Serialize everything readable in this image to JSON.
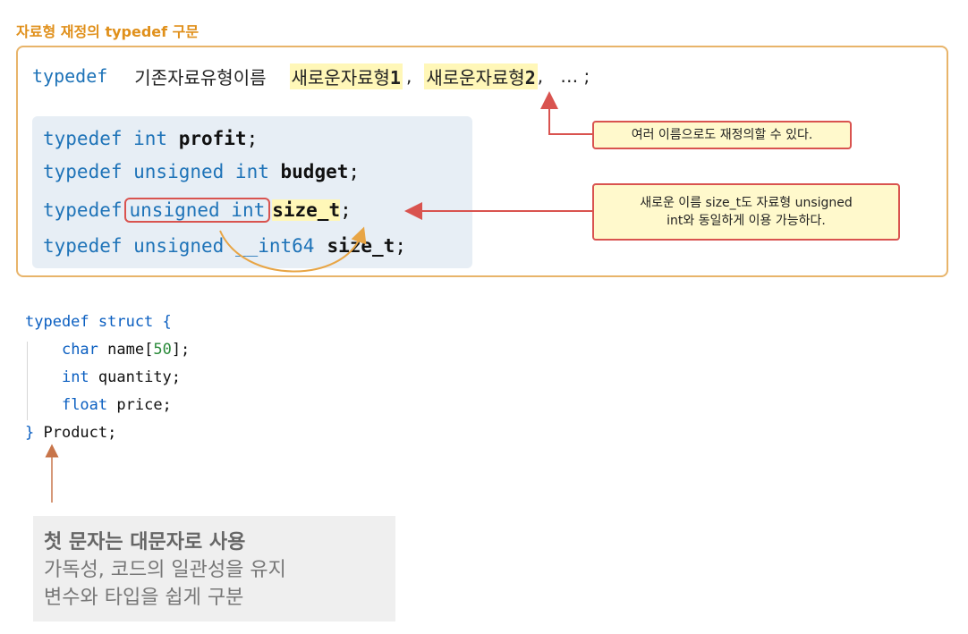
{
  "section_title": "자료형 재정의 typedef 구문",
  "syntax": {
    "keyword": "typedef",
    "base": "기존자료유형이름",
    "new1": "새로운자료형",
    "new1_num": "1",
    "sep1": ",",
    "new2": "새로운자료형",
    "new2_num": "2",
    "tail": ",   … ;"
  },
  "code": {
    "line1": {
      "kw": "typedef int ",
      "id": "profit",
      "end": ";"
    },
    "line2": {
      "kw": "typedef unsigned int ",
      "id": "budget",
      "end": ";"
    },
    "line3": {
      "kw": "typedef",
      "boxed": "unsigned int",
      "id": "size_t",
      "end": ";"
    },
    "line4": {
      "kw1": "typedef unsigned ",
      "kw2": "__int64",
      "id": "size_t",
      "end": ";"
    }
  },
  "callouts": {
    "first": "여러 이름으로도 재정의할 수 있다.",
    "second_line1": "새로운 이름 size_t도 자료형 unsigned",
    "second_line2": "int와 동일하게 이용 가능하다."
  },
  "struct_code": {
    "l1a": "typedef struct ",
    "l1b": "{",
    "l2a": "char ",
    "l2b": "name[",
    "l2c": "50",
    "l2d": "];",
    "l3a": "int ",
    "l3b": "quantity;",
    "l4a": "float ",
    "l4b": "price;",
    "l5a": "} ",
    "l5b": "Product;"
  },
  "note": {
    "head": "첫 문자는 대문자로 사용",
    "line2": "가독성, 코드의 일관성을 유지",
    "line3": "변수와 타입을 쉽게 구분"
  },
  "colors": {
    "accent_orange": "#e0901b",
    "frame_border": "#e8b46a",
    "keyword_blue": "#1e73b8",
    "highlight_yellow": "#fff7b8",
    "callout_red": "#d9534f",
    "arrow_orange": "#c8754a"
  }
}
